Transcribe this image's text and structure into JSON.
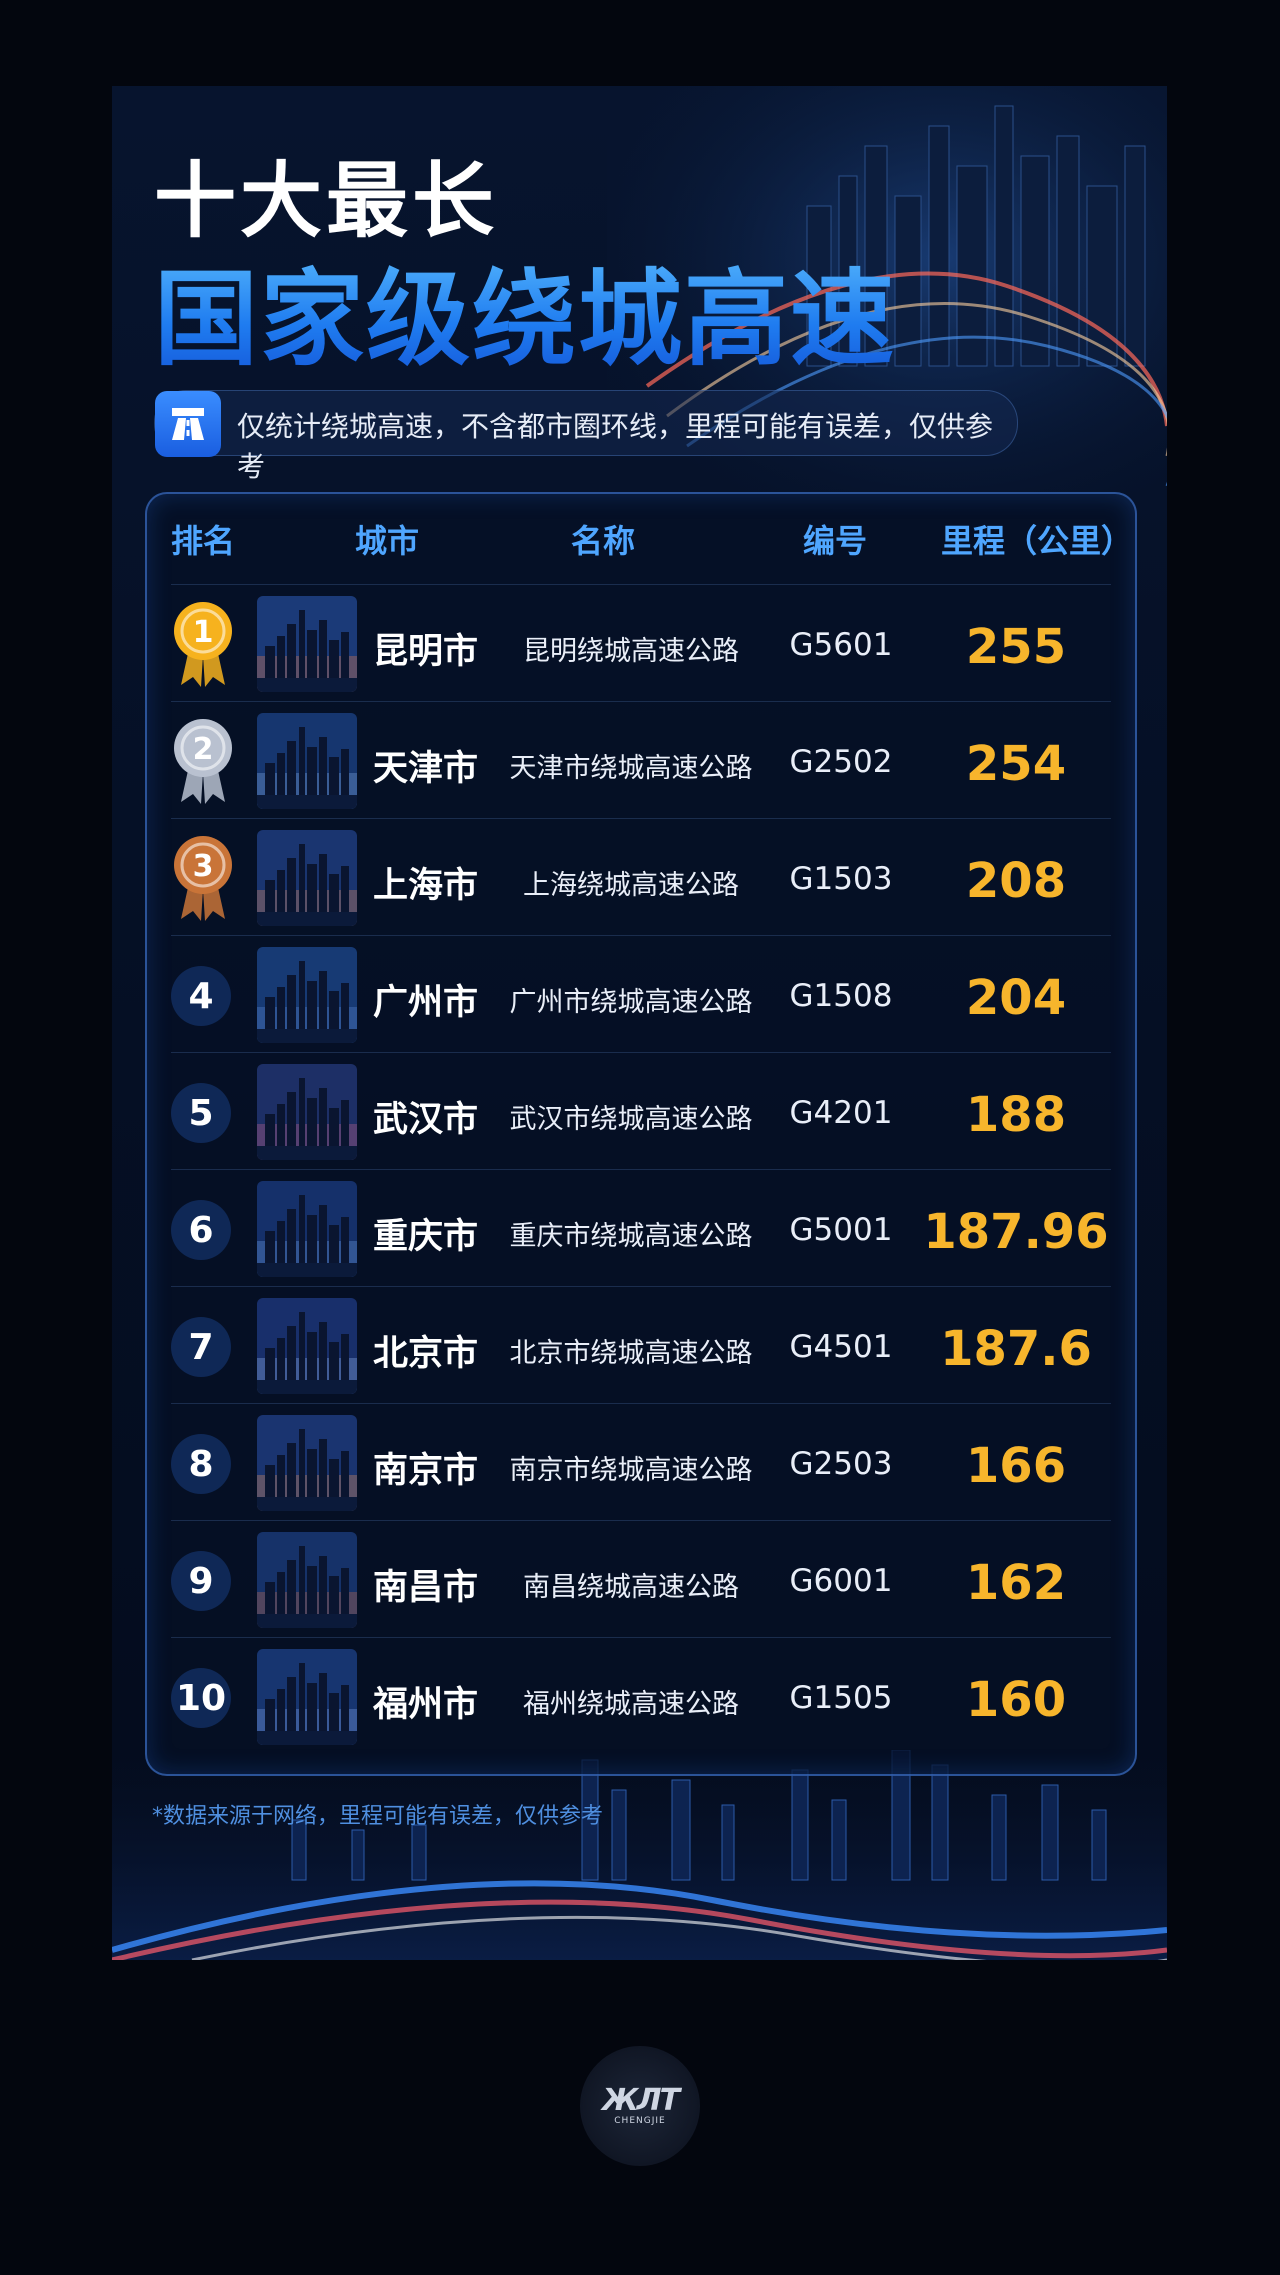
{
  "header": {
    "title_line1": "十大最长",
    "title_line2": "国家级绕城高速",
    "note": "仅统计绕城高速，不含都市圈环线，里程可能有误差，仅供参考",
    "note_icon": "highway-icon"
  },
  "table": {
    "columns": [
      "排名",
      "城市",
      "名称",
      "编号",
      "里程（公里）"
    ],
    "rows": [
      {
        "rank": "1",
        "city": "昆明市",
        "name": "昆明绕城高速公路",
        "code": "G5601",
        "km": "255",
        "medal": "gold"
      },
      {
        "rank": "2",
        "city": "天津市",
        "name": "天津市绕城高速公路",
        "code": "G2502",
        "km": "254",
        "medal": "silver"
      },
      {
        "rank": "3",
        "city": "上海市",
        "name": "上海绕城高速公路",
        "code": "G1503",
        "km": "208",
        "medal": "bronze"
      },
      {
        "rank": "4",
        "city": "广州市",
        "name": "广州市绕城高速公路",
        "code": "G1508",
        "km": "204"
      },
      {
        "rank": "5",
        "city": "武汉市",
        "name": "武汉市绕城高速公路",
        "code": "G4201",
        "km": "188"
      },
      {
        "rank": "6",
        "city": "重庆市",
        "name": "重庆市绕城高速公路",
        "code": "G5001",
        "km": "187.96"
      },
      {
        "rank": "7",
        "city": "北京市",
        "name": "北京市绕城高速公路",
        "code": "G4501",
        "km": "187.6"
      },
      {
        "rank": "8",
        "city": "南京市",
        "name": "南京市绕城高速公路",
        "code": "G2503",
        "km": "166"
      },
      {
        "rank": "9",
        "city": "南昌市",
        "name": "南昌绕城高速公路",
        "code": "G6001",
        "km": "162"
      },
      {
        "rank": "10",
        "city": "福州市",
        "name": "福州绕城高速公路",
        "code": "G1505",
        "km": "160"
      }
    ]
  },
  "footnote": "*数据来源于网络，里程可能有误差，仅供参考",
  "logo": {
    "mark": "ЖЛТ",
    "text": "CHENGJIE"
  },
  "colors": {
    "accent_blue": "#2f9dff",
    "km_gold": "#f7b52c",
    "gold": "#f6b21e",
    "silver": "#b9c1d0",
    "bronze": "#c97438"
  }
}
